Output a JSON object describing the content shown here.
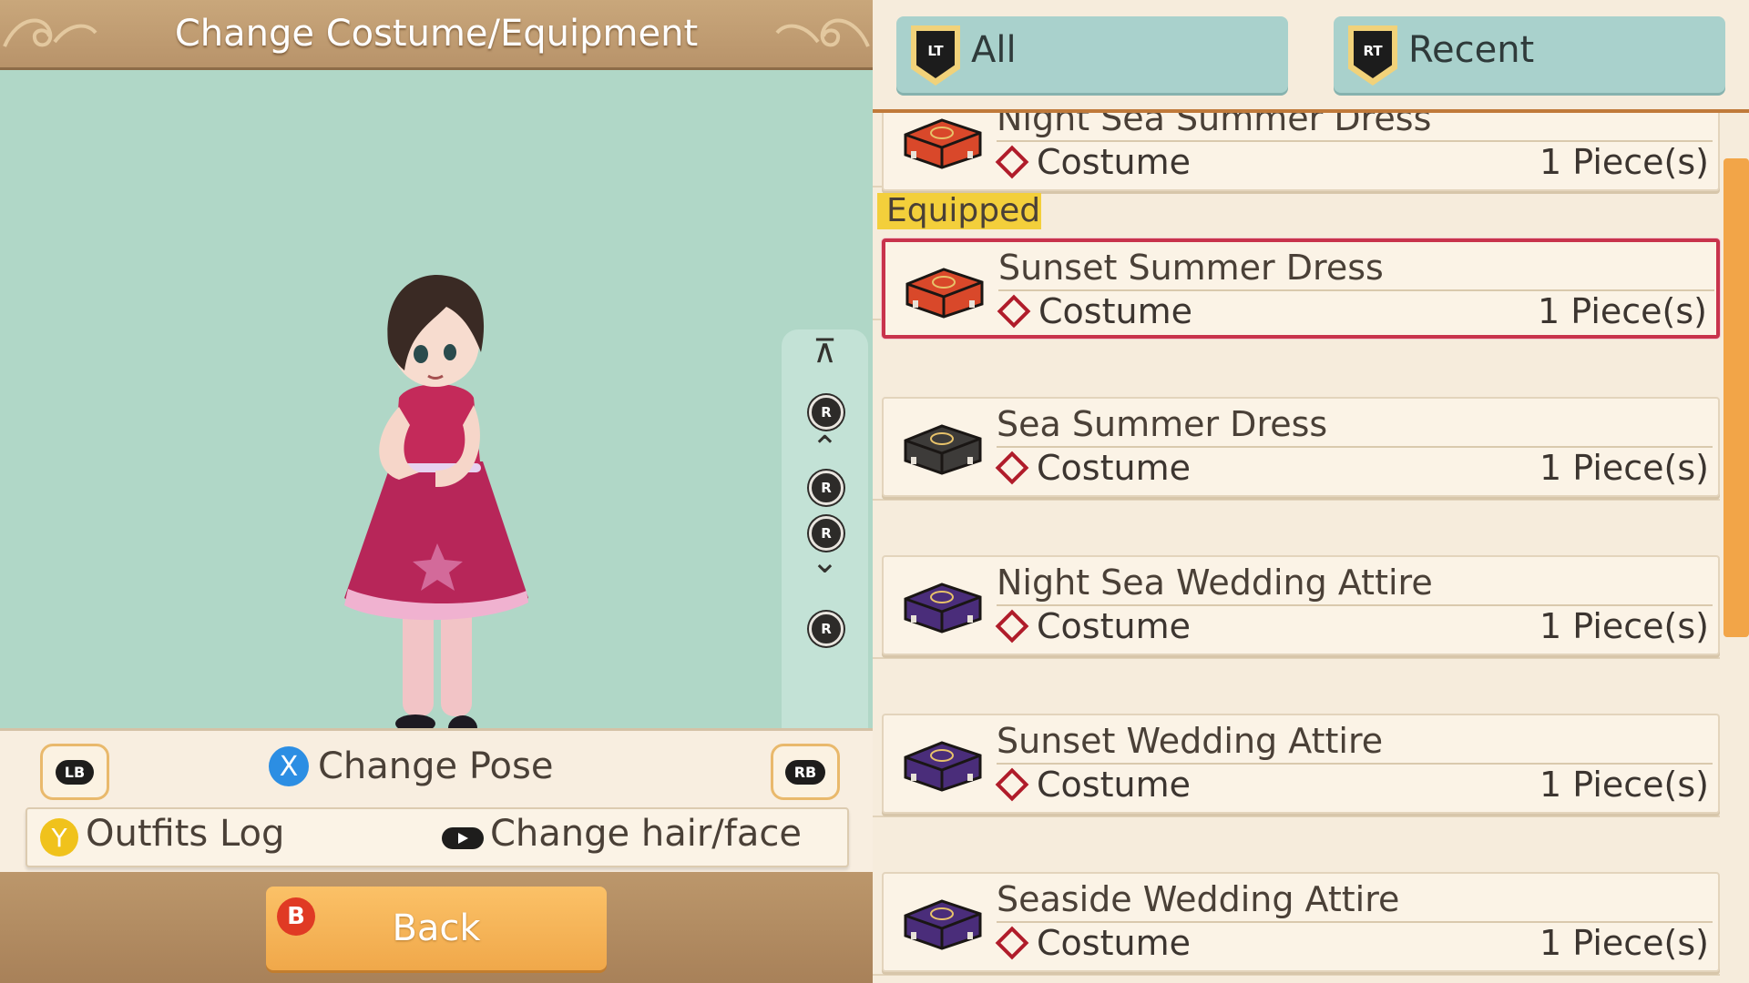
{
  "left_panel": {
    "title": "Change Costume/Equipment",
    "lb_label": "LB",
    "rb_label": "RB",
    "x_label": "X",
    "change_pose": "Change Pose",
    "y_label": "Y",
    "outfits_log": "Outfits Log",
    "change_hair_face": "Change hair/face",
    "b_label": "B",
    "back": "Back",
    "r_label": "R"
  },
  "tabs": [
    {
      "trigger": "LT",
      "label": "All"
    },
    {
      "trigger": "RT",
      "label": "Recent"
    }
  ],
  "equipped_label": "Equipped",
  "items": [
    {
      "name": "Night Sea Summer Dress",
      "category": "Costume",
      "qty": "1 Piece(s)",
      "case_color": "#d9482a",
      "partial": true
    },
    {
      "name": "Sunset Summer Dress",
      "category": "Costume",
      "qty": "1 Piece(s)",
      "case_color": "#d9482a",
      "selected": true
    },
    {
      "name": "Sea Summer Dress",
      "category": "Costume",
      "qty": "1 Piece(s)",
      "case_color": "#3d3b39"
    },
    {
      "name": "Night Sea Wedding Attire",
      "category": "Costume",
      "qty": "1 Piece(s)",
      "case_color": "#4a2d7a"
    },
    {
      "name": "Sunset Wedding Attire",
      "category": "Costume",
      "qty": "1 Piece(s)",
      "case_color": "#4a2d7a"
    },
    {
      "name": "Seaside Wedding Attire",
      "category": "Costume",
      "qty": "1 Piece(s)",
      "case_color": "#4a2d7a"
    }
  ],
  "colors": {
    "preview_bg": "#b0d7c7",
    "tab_bg": "#a9d1cc",
    "selected_border": "#c8334c",
    "equipped_tag": "#f3cf3b",
    "back_button": "#f0a84a"
  }
}
